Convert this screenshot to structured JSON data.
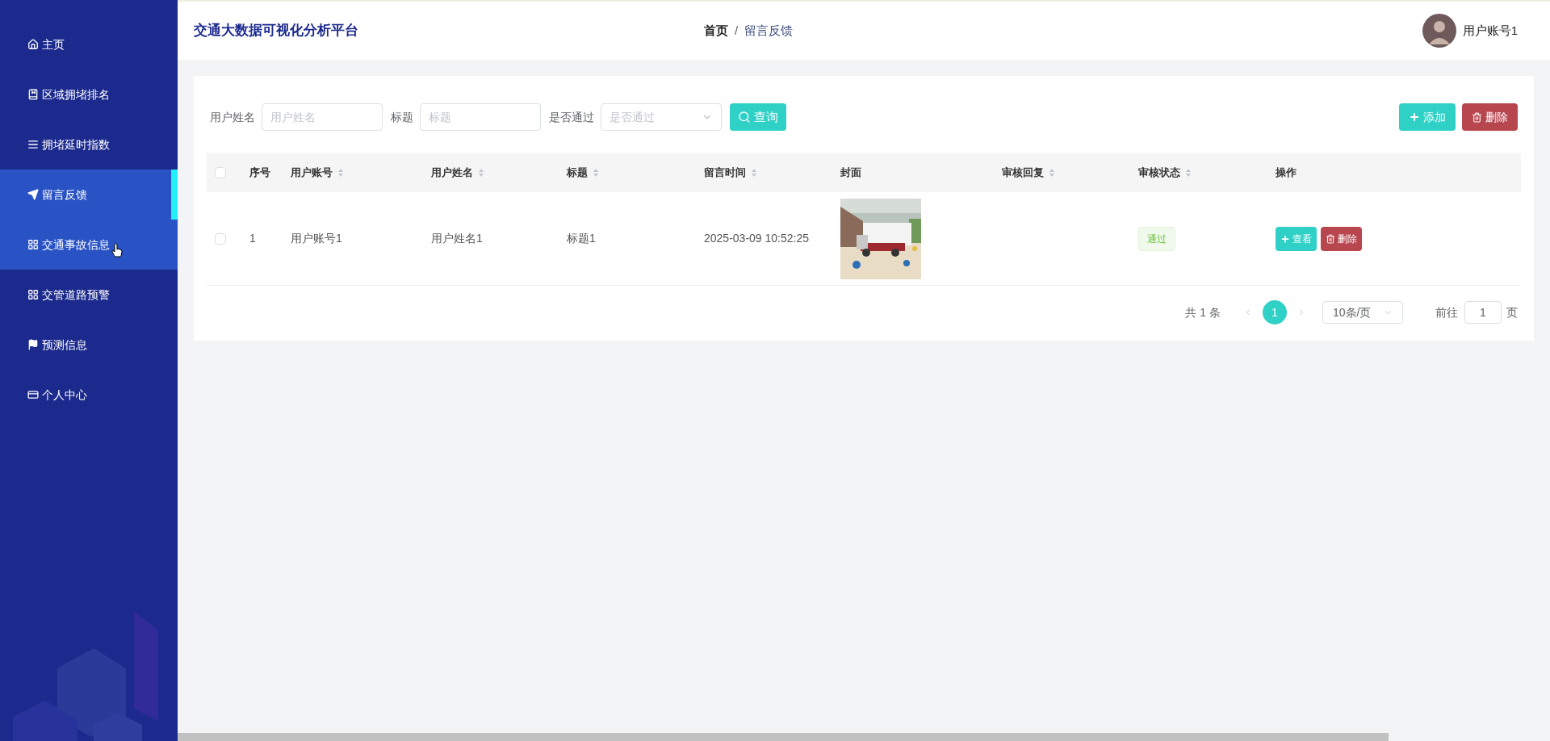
{
  "sidebar": {
    "items": [
      {
        "label": "主页",
        "selected": false,
        "hovered": false
      },
      {
        "label": "区域拥堵排名",
        "selected": false,
        "hovered": false
      },
      {
        "label": "拥堵延时指数",
        "selected": false,
        "hovered": false
      },
      {
        "label": "留言反馈",
        "selected": true,
        "hovered": false
      },
      {
        "label": "交通事故信息",
        "selected": false,
        "hovered": true
      },
      {
        "label": "交管道路预警",
        "selected": false,
        "hovered": false
      },
      {
        "label": "预测信息",
        "selected": false,
        "hovered": false
      },
      {
        "label": "个人中心",
        "selected": false,
        "hovered": false
      }
    ]
  },
  "header": {
    "title": "交通大数据可视化分析平台",
    "breadcrumb": [
      "首页",
      "留言反馈"
    ],
    "breadcrumb_separator": "/",
    "user": "用户账号1"
  },
  "filters": [
    {
      "label": "用户姓名",
      "kind": "input",
      "placeholder": "用户姓名"
    },
    {
      "label": "标题",
      "kind": "input",
      "placeholder": "标题"
    },
    {
      "label": "是否通过",
      "kind": "select",
      "placeholder": "是否通过"
    }
  ],
  "search_button": "查询",
  "toolbar": [
    {
      "label": "添加",
      "kind": "add"
    },
    {
      "label": "删除",
      "kind": "delete"
    }
  ],
  "table": {
    "header_checked": false,
    "columns": [
      {
        "label": "序号",
        "sortable": false
      },
      {
        "label": "用户账号",
        "sortable": true
      },
      {
        "label": "用户姓名",
        "sortable": true
      },
      {
        "label": "标题",
        "sortable": true
      },
      {
        "label": "留言时间",
        "sortable": true
      },
      {
        "label": "封面",
        "sortable": false
      },
      {
        "label": "审核回复",
        "sortable": true
      },
      {
        "label": "审核状态",
        "sortable": true
      },
      {
        "label": "操作",
        "sortable": false
      }
    ],
    "rows": [
      {
        "checked": false,
        "index": "1",
        "account": "用户账号1",
        "name": "用户姓名1",
        "title": "标题1",
        "time": "2025-03-09 10:52:25",
        "cover": {
          "kind": "picture"
        },
        "status": "通过",
        "actions": [
          {
            "label": "查看",
            "kind": "add"
          },
          {
            "label": "删除",
            "kind": "delete"
          }
        ]
      }
    ]
  },
  "pagination": {
    "total": "共 1 条",
    "pages": [
      {
        "label": "1",
        "selected": true
      }
    ],
    "page_size": "10条/页",
    "goto_label": "前往",
    "goto_value": "1",
    "goto_suffix": "页"
  }
}
